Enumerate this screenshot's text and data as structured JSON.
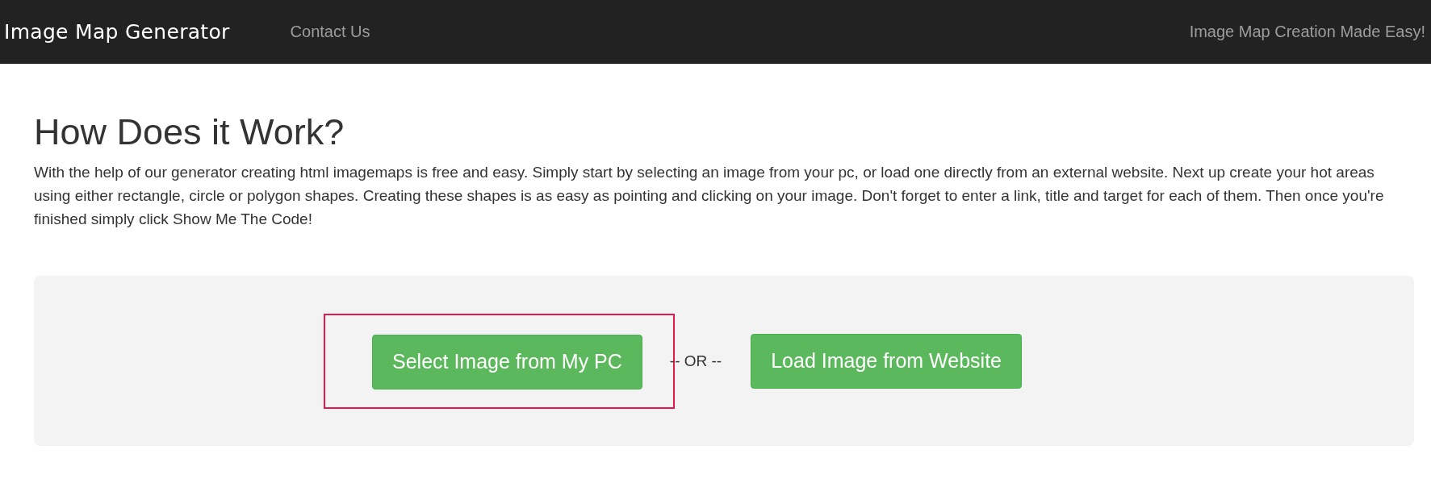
{
  "navbar": {
    "brand": "Image Map Generator",
    "links": [
      {
        "label": "Contact Us"
      }
    ],
    "tagline": "Image Map Creation Made Easy!"
  },
  "intro": {
    "heading": "How Does it Work?",
    "text": "With the help of our generator creating html imagemaps is free and easy. Simply start by selecting an image from your pc, or load one directly from an external website. Next up create your hot areas using either rectangle, circle or polygon shapes. Creating these shapes is as easy as pointing and clicking on your image. Don't forget to enter a link, title and target for each of them. Then once you're finished simply click Show Me The Code!"
  },
  "upload": {
    "buttons": [
      {
        "label": "Select Image from My PC",
        "highlighted": true
      },
      {
        "label": "Load Image from Website",
        "highlighted": false
      }
    ],
    "separator": "-- OR --"
  }
}
